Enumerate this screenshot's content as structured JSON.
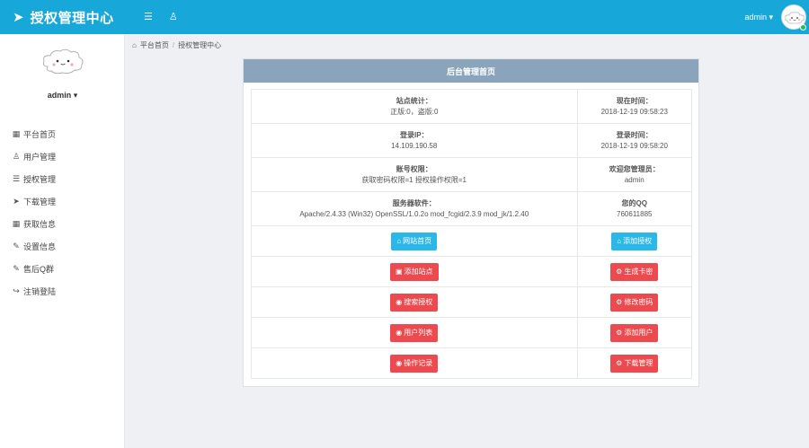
{
  "header": {
    "title": "授权管理中心",
    "username": "admin"
  },
  "sidebar": {
    "username": "admin",
    "items": [
      {
        "label": "平台首页",
        "icon": "grid-icon"
      },
      {
        "label": "用户管理",
        "icon": "user-icon"
      },
      {
        "label": "授权管理",
        "icon": "layers-icon"
      },
      {
        "label": "下载管理",
        "icon": "rocket-icon"
      },
      {
        "label": "获取信息",
        "icon": "grid-icon"
      },
      {
        "label": "设置信息",
        "icon": "edit-icon"
      },
      {
        "label": "售后Q群",
        "icon": "edit-icon"
      },
      {
        "label": "注销登陆",
        "icon": "logout-icon"
      }
    ]
  },
  "breadcrumb": {
    "home": "平台首页",
    "current": "授权管理中心"
  },
  "panel": {
    "title": "后台管理首页",
    "info": [
      {
        "lk": "站点统计：",
        "lv": "正版:0，盗版:0",
        "rk": "现在时间：",
        "rv": "2018-12-19 09:58:23"
      },
      {
        "lk": "登录IP：",
        "lv": "14.109.190.58",
        "rk": "登录时间：",
        "rv": "2018-12-19 09:58:20"
      },
      {
        "lk": "账号权限：",
        "lv": "获取密码权限=1 授权操作权限=1",
        "rk": "欢迎您管理员：",
        "rv": "admin"
      },
      {
        "lk": "服务器软件：",
        "lv": "Apache/2.4.33 (Win32) OpenSSL/1.0.2o mod_fcgid/2.3.9 mod_jk/1.2.40",
        "rk": "您的QQ",
        "rv": "760611885"
      }
    ],
    "buttons": [
      {
        "left": "网站首页",
        "left_color": "blue",
        "left_icon": "home-icon",
        "right": "添加授权",
        "right_color": "blue",
        "right_icon": "home-icon"
      },
      {
        "left": "添加站点",
        "left_color": "red",
        "left_icon": "folder-icon",
        "right": "生成卡密",
        "right_color": "red",
        "right_icon": "gear-icon"
      },
      {
        "left": "搜索授权",
        "left_color": "red",
        "left_icon": "globe-icon",
        "right": "修改密码",
        "right_color": "red",
        "right_icon": "gear-icon"
      },
      {
        "left": "用户列表",
        "left_color": "red",
        "left_icon": "globe-icon",
        "right": "添加用户",
        "right_color": "red",
        "right_icon": "gear-icon"
      },
      {
        "left": "操作记录",
        "left_color": "red",
        "left_icon": "globe-icon",
        "right": "下载管理",
        "right_color": "red",
        "right_icon": "gear-icon"
      }
    ]
  },
  "colors": {
    "header": "#17a8d9",
    "panel_head": "#8aa4bb",
    "button_blue": "#2bb7e8",
    "button_red": "#ec4a4e"
  }
}
